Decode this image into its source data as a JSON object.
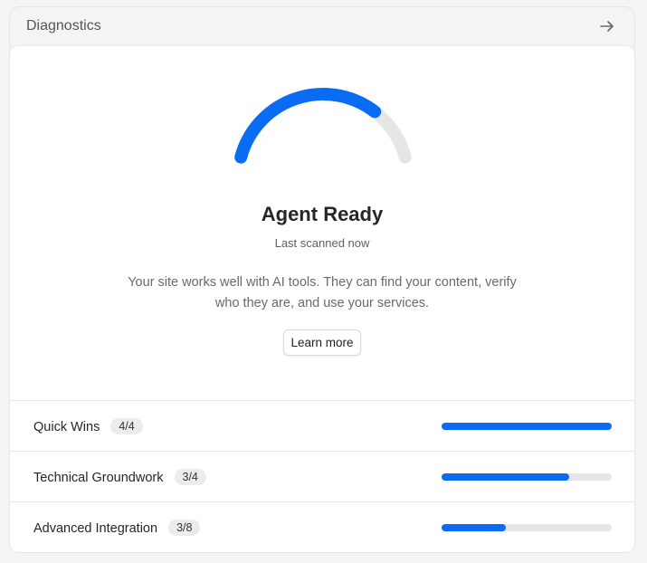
{
  "header": {
    "title": "Diagnostics",
    "arrow_icon": "arrow-right-icon"
  },
  "summary": {
    "gauge_level": 0.75,
    "status": "Agent Ready",
    "last_scanned": "Last scanned now",
    "description": "Your site works well with AI tools. They can find your content, verify who they are, and use your services.",
    "learn_more_label": "Learn more"
  },
  "colors": {
    "accent": "#0a6cf2",
    "track": "#e6e6e6"
  },
  "categories": [
    {
      "label": "Quick Wins",
      "score": "4/4",
      "progress": 1.0
    },
    {
      "label": "Technical Groundwork",
      "score": "3/4",
      "progress": 0.75
    },
    {
      "label": "Advanced Integration",
      "score": "3/8",
      "progress": 0.375
    }
  ]
}
